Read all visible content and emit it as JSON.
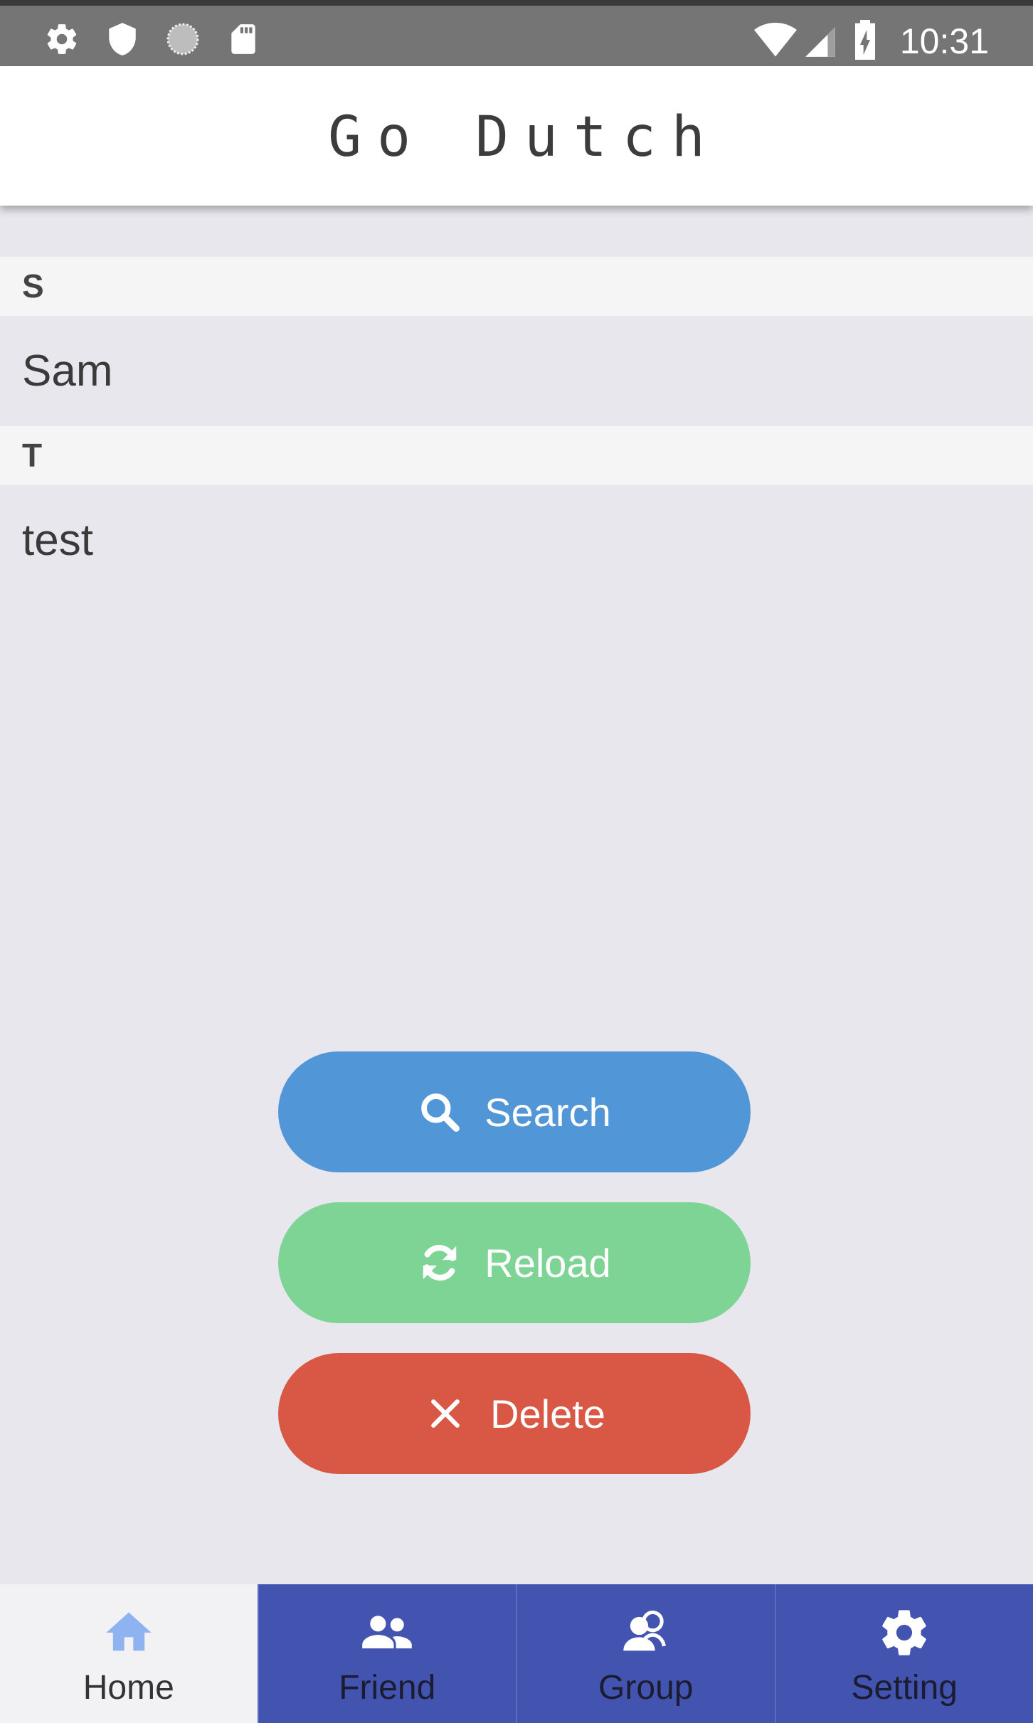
{
  "status_bar": {
    "time": "10:31",
    "left_icons": [
      "settings-icon",
      "shield-icon",
      "sync-circle-icon",
      "sd-card-icon"
    ],
    "right_icons": [
      "wifi-icon",
      "cell-signal-icon",
      "battery-charging-icon"
    ]
  },
  "app_bar": {
    "title": "Go Dutch"
  },
  "contacts": {
    "sections": [
      {
        "header": "S",
        "items": [
          "Sam"
        ]
      },
      {
        "header": "T",
        "items": [
          "test"
        ]
      }
    ]
  },
  "actions": {
    "search": {
      "label": "Search",
      "icon": "search-icon",
      "color": "#5196d6"
    },
    "reload": {
      "label": "Reload",
      "icon": "refresh-icon",
      "color": "#7dd494"
    },
    "delete": {
      "label": "Delete",
      "icon": "close-icon",
      "color": "#d85845"
    }
  },
  "bottom_nav": {
    "active": "Home",
    "active_color": "#8fb2f0",
    "tab_color": "#4253b0",
    "tabs": [
      {
        "label": "Home",
        "icon": "home-icon"
      },
      {
        "label": "Friend",
        "icon": "people-icon"
      },
      {
        "label": "Group",
        "icon": "group-icon"
      },
      {
        "label": "Setting",
        "icon": "gear-icon"
      }
    ]
  }
}
